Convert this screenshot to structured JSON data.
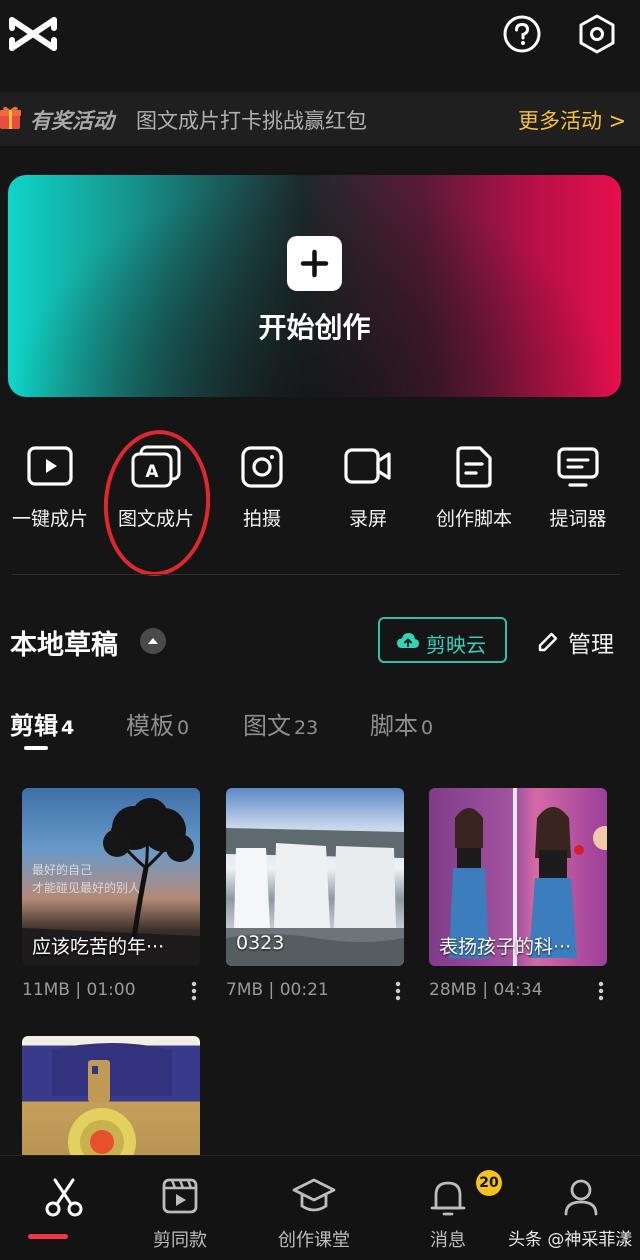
{
  "header": {
    "logo_icon": "capcut-logo-icon",
    "help_icon": "help-icon",
    "settings_icon": "settings-hexagon-icon"
  },
  "activity": {
    "title": "有奖活动",
    "description": "图文成片打卡挑战赢红包",
    "more_label": "更多活动 >"
  },
  "create": {
    "label": "开始创作",
    "icon": "plus-icon"
  },
  "tools": [
    {
      "label": "一键成片",
      "icon": "play-icon"
    },
    {
      "label": "图文成片",
      "icon": "text-image-icon"
    },
    {
      "label": "拍摄",
      "icon": "camera-icon"
    },
    {
      "label": "录屏",
      "icon": "video-record-icon"
    },
    {
      "label": "创作脚本",
      "icon": "script-icon"
    },
    {
      "label": "提词器",
      "icon": "teleprompter-icon"
    }
  ],
  "drafts": {
    "title": "本地草稿",
    "cloud_label": "剪映云",
    "manage_label": "管理",
    "tabs": [
      {
        "label": "剪辑",
        "count": "4",
        "active": true
      },
      {
        "label": "模板",
        "count": "0",
        "active": false
      },
      {
        "label": "图文",
        "count": "23",
        "active": false
      },
      {
        "label": "脚本",
        "count": "0",
        "active": false
      }
    ],
    "items": [
      {
        "title": "应该吃苦的年···",
        "size": "11MB",
        "duration": "01:00"
      },
      {
        "title": "0323",
        "size": "7MB",
        "duration": "00:21"
      },
      {
        "title": "表扬孩子的科···",
        "size": "28MB",
        "duration": "04:34"
      },
      {
        "title": "",
        "size": "",
        "duration": ""
      }
    ]
  },
  "bottom_nav": {
    "items": [
      {
        "label": "",
        "icon": "scissors-icon",
        "active": true
      },
      {
        "label": "剪同款",
        "icon": "template-clip-icon"
      },
      {
        "label": "创作课堂",
        "icon": "graduation-cap-icon"
      },
      {
        "label": "消息",
        "icon": "bell-icon"
      },
      {
        "label": "",
        "icon": "user-icon"
      }
    ],
    "message_badge": "20"
  },
  "watermark": "头条 @神采菲漾",
  "colors": {
    "background": "#151515",
    "accent_teal": "#34d1bb",
    "accent_yellow": "#f5c33b",
    "accent_red": "#f0344a"
  }
}
